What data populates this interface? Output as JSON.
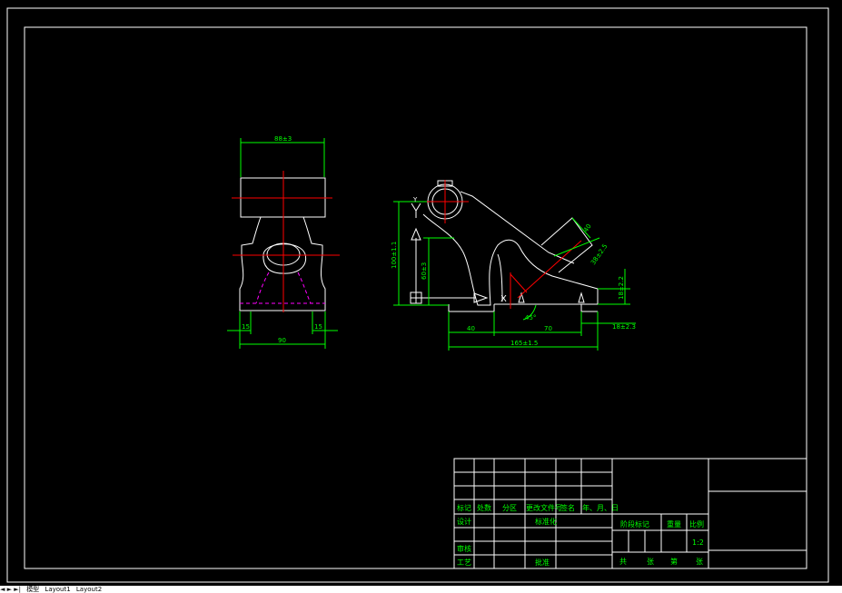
{
  "colors": {
    "background": "#000000",
    "outline": "#ffffff",
    "dimension": "#00ff00",
    "centerline": "#ff0000",
    "hidden": "#ff00ff",
    "titleblock_text": "#00ff00"
  },
  "front_view": {
    "dim_top": "88±3",
    "dim_left_bottom": "15",
    "dim_right_bottom": "15",
    "dim_bottom": "90"
  },
  "side_view": {
    "dim_height": "100±1.1",
    "dim_inner_height": "60±3",
    "dim_left": "40",
    "dim_mid": "70",
    "dim_total": "165±1.5",
    "dim_angle": "45°",
    "dim_slot": "40",
    "dim_slant": "38±2.5",
    "dim_right_v": "18±2.2",
    "dim_right_h": "18±2.3",
    "datum_y": "Y",
    "datum_x": "X"
  },
  "title_block": {
    "row_headers": [
      "标记",
      "处数",
      "分区",
      "更改文件号",
      "签名",
      "年、月、日"
    ],
    "design": "设计",
    "standardize": "标准化",
    "stage_mark": "阶段标记",
    "weight": "重量",
    "scale": "比例",
    "scale_value": "1:2",
    "review": "审核",
    "process": "工艺",
    "approve": "批准",
    "total": "共",
    "sheets": "张",
    "page": "第",
    "sheet2": "张"
  },
  "tabs": {
    "nav": "◄ ► ►| ",
    "model": "模型",
    "layout1": "Layout1",
    "layout2": "Layout2"
  }
}
